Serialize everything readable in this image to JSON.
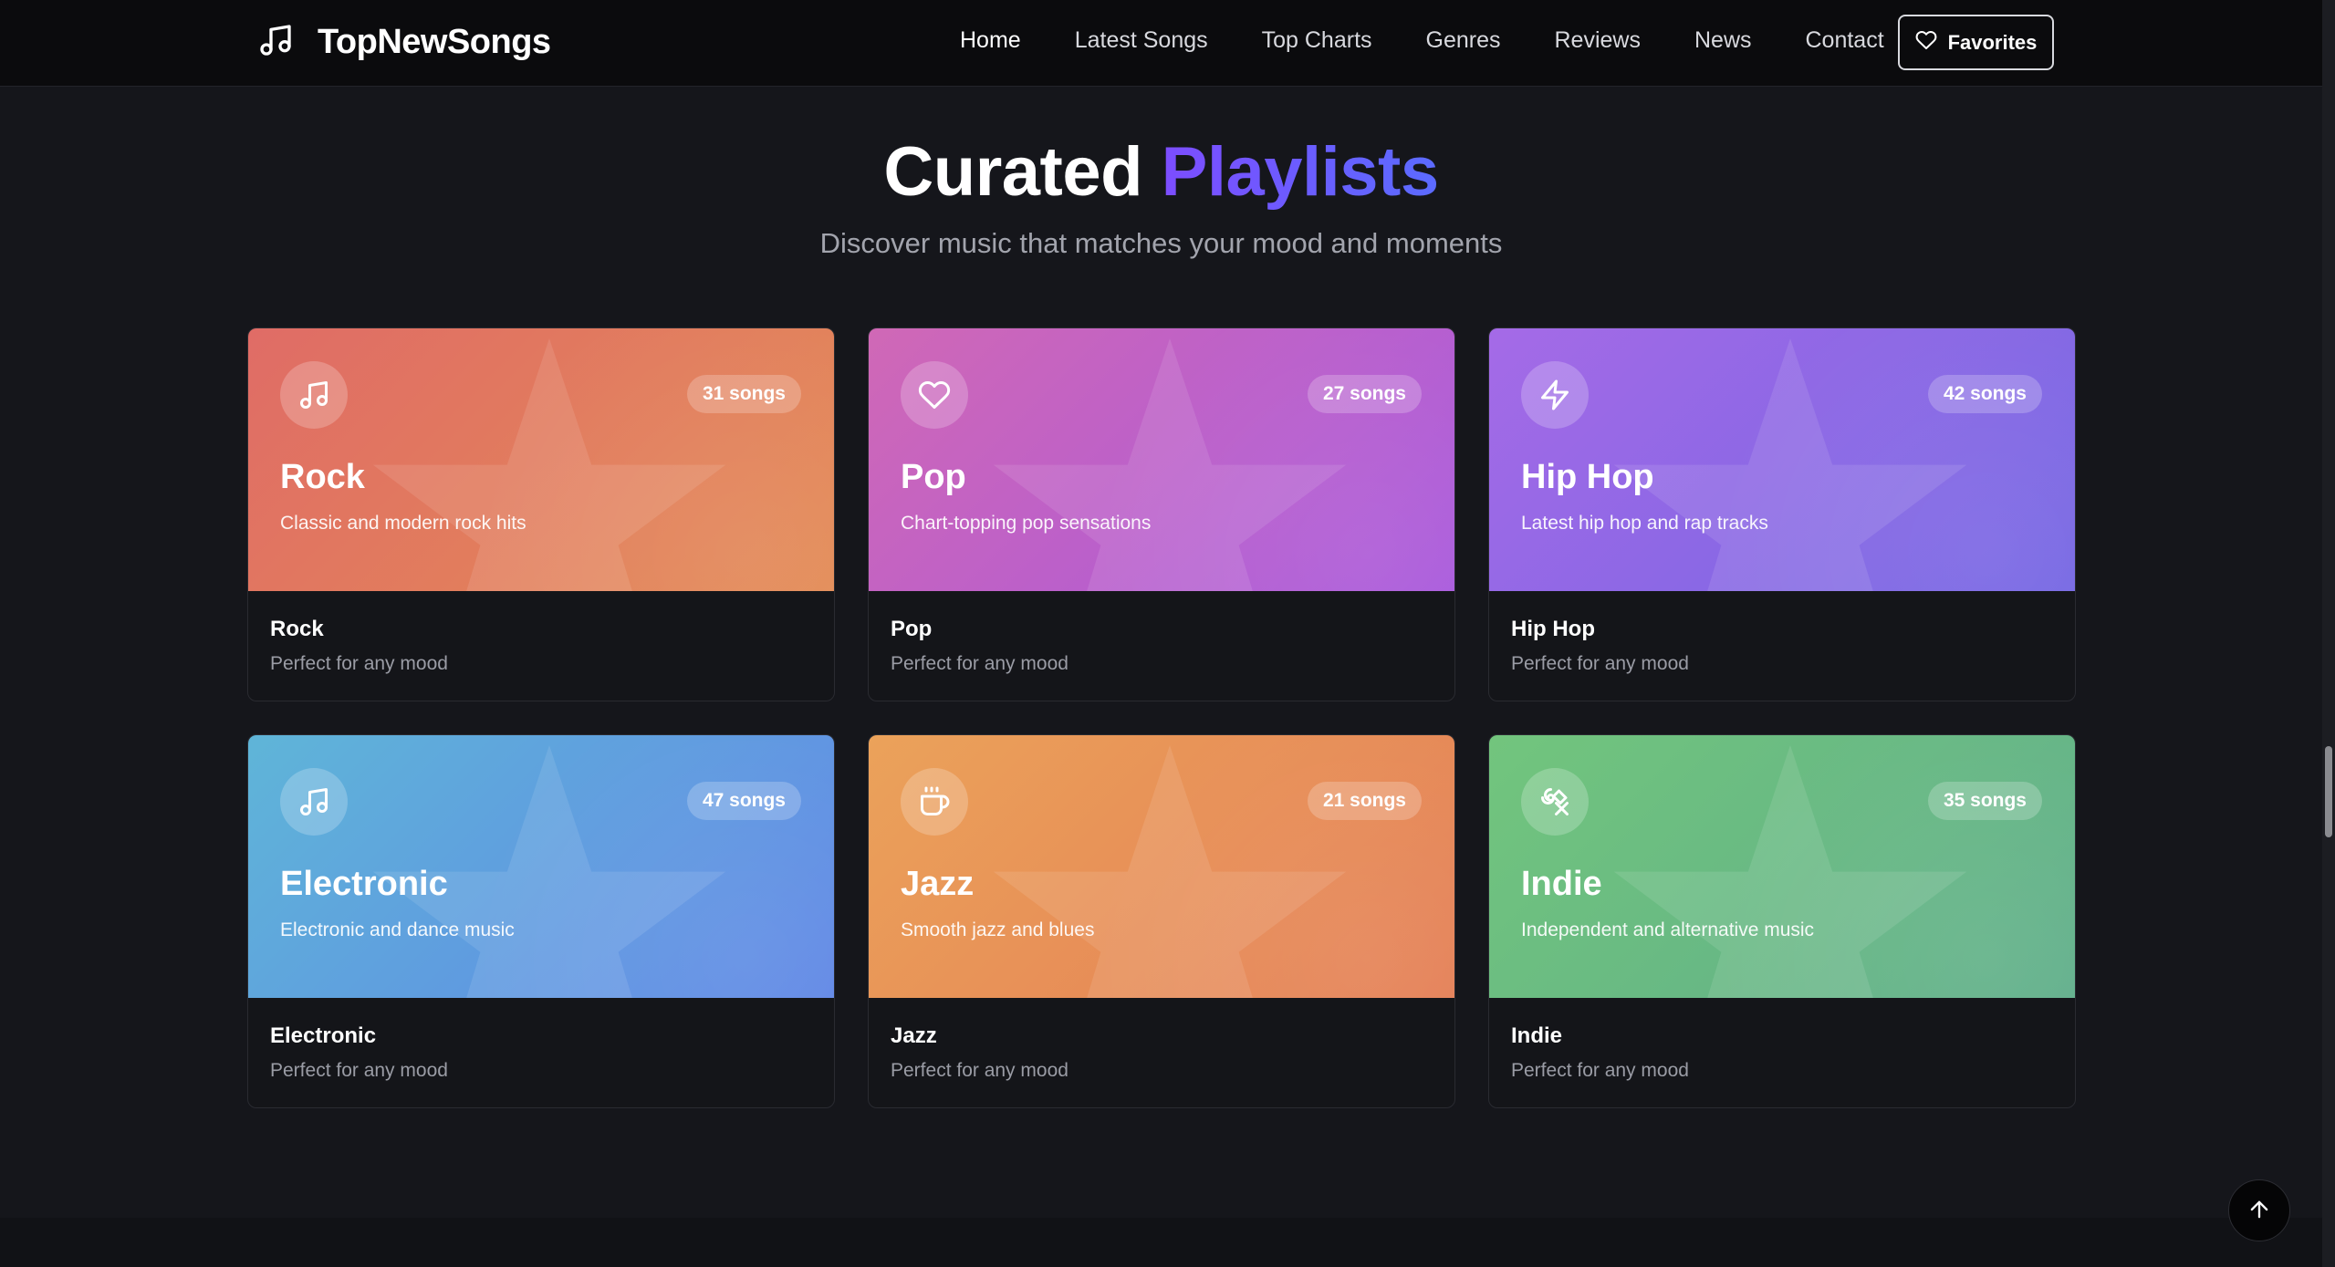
{
  "brand": {
    "name": "TopNewSongs",
    "icon": "music-note-icon"
  },
  "nav": {
    "links": [
      {
        "label": "Home",
        "active": true
      },
      {
        "label": "Latest Songs",
        "active": false
      },
      {
        "label": "Top Charts",
        "active": false
      },
      {
        "label": "Genres",
        "active": false
      },
      {
        "label": "Reviews",
        "active": false
      },
      {
        "label": "News",
        "active": false
      },
      {
        "label": "Contact",
        "active": false
      }
    ],
    "favorites_label": "Favorites"
  },
  "section": {
    "title_main": "Curated",
    "title_accent": "Playlists",
    "subtitle": "Discover music that matches your mood and moments"
  },
  "playlists": [
    {
      "title": "Rock",
      "count": "31 songs",
      "description": "Classic and modern rock hits",
      "name": "Rock",
      "mood": "Perfect for any mood",
      "icon": "music-note-icon",
      "gradient": [
        "#e06c66",
        "#e38b55"
      ]
    },
    {
      "title": "Pop",
      "count": "27 songs",
      "description": "Chart-topping pop sensations",
      "name": "Pop",
      "mood": "Perfect for any mood",
      "icon": "heart-icon",
      "gradient": [
        "#d068b6",
        "#a858dc"
      ]
    },
    {
      "title": "Hip Hop",
      "count": "42 songs",
      "description": "Latest hip hop and rap tracks",
      "name": "Hip Hop",
      "mood": "Perfect for any mood",
      "icon": "lightning-icon",
      "gradient": [
        "#a56ae7",
        "#7466e3"
      ]
    },
    {
      "title": "Electronic",
      "count": "47 songs",
      "description": "Electronic and dance music",
      "name": "Electronic",
      "mood": "Perfect for any mood",
      "icon": "music-note-icon",
      "gradient": [
        "#5fb5d8",
        "#5f86e6"
      ]
    },
    {
      "title": "Jazz",
      "count": "21 songs",
      "description": "Smooth jazz and blues",
      "name": "Jazz",
      "mood": "Perfect for any mood",
      "icon": "coffee-icon",
      "gradient": [
        "#eba25a",
        "#e47e55"
      ]
    },
    {
      "title": "Indie",
      "count": "35 songs",
      "description": "Independent and alternative music",
      "name": "Indie",
      "mood": "Perfect for any mood",
      "icon": "palette-icon",
      "gradient": [
        "#72c57d",
        "#5fae8a"
      ]
    }
  ]
}
